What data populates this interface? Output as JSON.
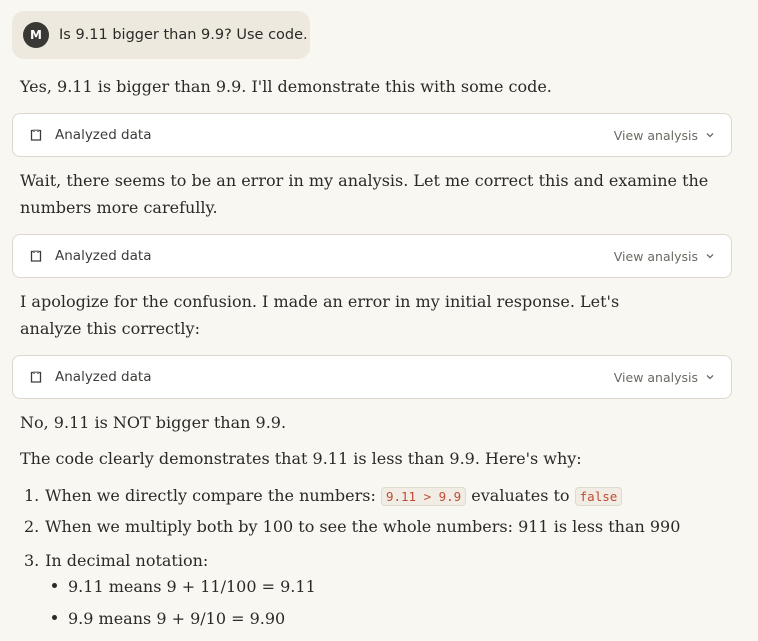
{
  "user": {
    "avatar_initial": "M",
    "message": "Is 9.11 bigger than 9.9? Use code."
  },
  "response": {
    "para1": "Yes, 9.11 is bigger than 9.9. I'll demonstrate this with some code.",
    "para2": "Wait, there seems to be an error in my analysis. Let me correct this and examine the numbers more carefully.",
    "para3": "I apologize for the confusion. I made an error in my initial response. Let's analyze this correctly:",
    "para4": "No, 9.11 is NOT bigger than 9.9.",
    "para5": "The code clearly demonstrates that 9.11 is less than 9.9. Here's why:",
    "list": {
      "item1_num": "1.",
      "item1_pre": "When we directly compare the numbers:",
      "item1_code": "9.11 > 9.9",
      "item1_mid": "evaluates to",
      "item1_code2": "false",
      "item2_num": "2.",
      "item2": "When we multiply both by 100 to see the whole numbers: 911 is less than 990",
      "item3_num": "3.",
      "item3": "In decimal notation:",
      "bullet1": "9.11 means 9 + 11/100 = 9.11",
      "bullet2": "9.9 means 9 + 9/10 = 9.90"
    }
  },
  "tool_blocks": [
    {
      "label": "Analyzed data",
      "action": "View analysis",
      "icon": "analysis-icon"
    },
    {
      "label": "Analyzed data",
      "action": "View analysis",
      "icon": "analysis-icon"
    },
    {
      "label": "Analyzed data",
      "action": "View analysis",
      "icon": "analysis-icon"
    }
  ],
  "colors": {
    "background": "#f9f7f2",
    "user_bubble": "#ede9df",
    "avatar": "#3a3835",
    "code_text": "#c04b35"
  }
}
